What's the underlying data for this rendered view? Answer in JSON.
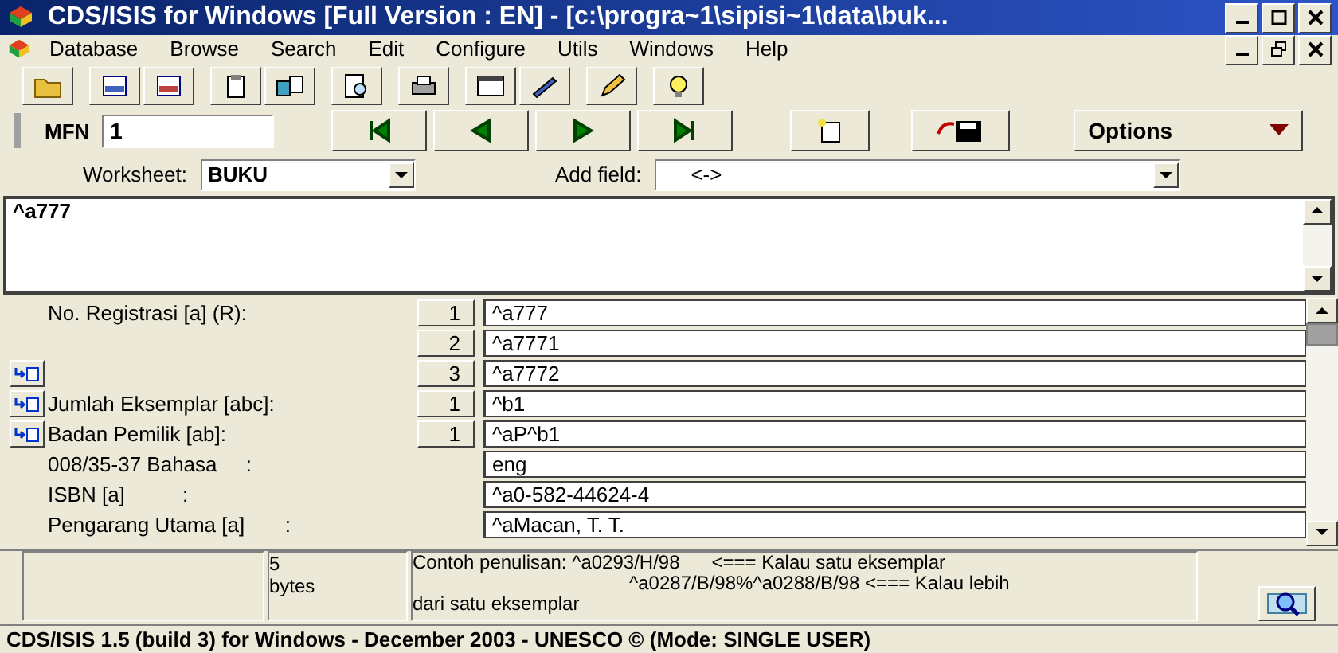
{
  "window": {
    "title": "CDS/ISIS for Windows [Full Version : EN] - [c:\\progra~1\\sipisi~1\\data\\buk..."
  },
  "menu": [
    {
      "label": "Database"
    },
    {
      "label": "Browse"
    },
    {
      "label": "Search"
    },
    {
      "label": "Edit"
    },
    {
      "label": "Configure"
    },
    {
      "label": "Utils"
    },
    {
      "label": "Windows"
    },
    {
      "label": "Help"
    }
  ],
  "nav": {
    "mfn_label": "MFN",
    "mfn_value": "1",
    "options_label": "Options"
  },
  "worksheet": {
    "label": "Worksheet:",
    "value": "BUKU",
    "add_field_label": "Add field:",
    "add_field_value": "<->"
  },
  "editor": {
    "value": "^a777"
  },
  "fields": [
    {
      "label": "No. Registrasi [a] (R):",
      "occurrence": "1",
      "value": "^a777",
      "repeat_button": false
    },
    {
      "occurrence": "2",
      "value": "^a7771",
      "repeat_button": false
    },
    {
      "occurrence": "3",
      "value": "^a7772",
      "repeat_button": true
    },
    {
      "label": "Jumlah Eksemplar [abc]:",
      "occurrence": "1",
      "value": "^b1",
      "repeat_button": true
    },
    {
      "label": "Badan Pemilik [ab]:",
      "occurrence": "1",
      "value": "^aP^b1",
      "repeat_button": true
    },
    {
      "label": "008/35-37 Bahasa     :",
      "value": "eng",
      "repeat_button": false
    },
    {
      "label": "ISBN [a]          :",
      "value": "^a0-582-44624-4",
      "repeat_button": false
    },
    {
      "label": "Pengarang Utama [a]       :",
      "value": "^aMacan, T. T.",
      "repeat_button": false
    }
  ],
  "info": {
    "size_value": "5",
    "size_unit": "bytes",
    "hint_line1": "Contoh penulisan: ^a0293/H/98      <=== Kalau satu eksemplar",
    "hint_line2": "^a0287/B/98%^a0288/B/98 <=== Kalau lebih",
    "hint_line3": "dari satu eksemplar"
  },
  "status_bar": "CDS/ISIS 1.5 (build 3) for Windows - December 2003 - UNESCO © (Mode: SINGLE USER)"
}
